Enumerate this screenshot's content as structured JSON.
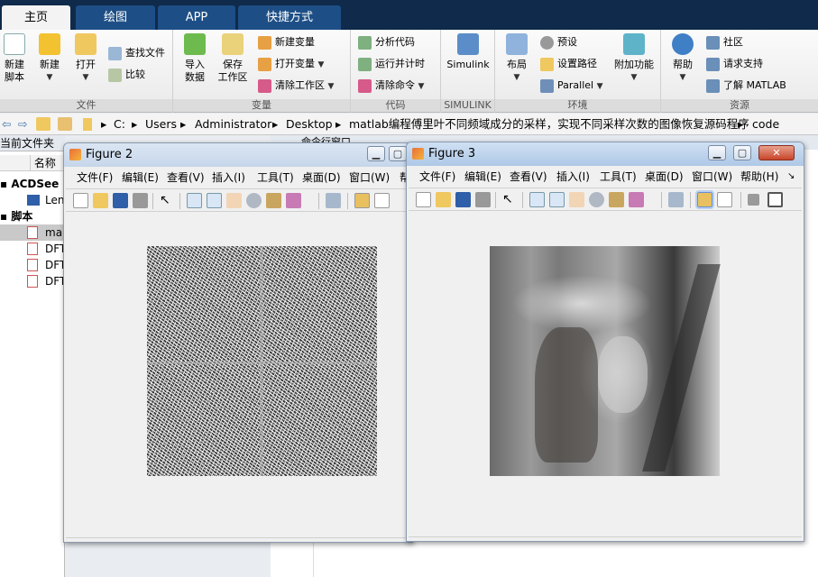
{
  "ribbon_tabs": [
    "主页",
    "绘图",
    "APP",
    "快捷方式"
  ],
  "ribbon": {
    "file": {
      "label": "文件",
      "new_script": "新建\n脚本",
      "new": "新建",
      "open": "打开",
      "find_files": "查找文件",
      "compare": "比较"
    },
    "variable": {
      "label": "变量",
      "import": "导入\n数据",
      "save_ws": "保存\n工作区",
      "new_var": "新建变量",
      "open_var": "打开变量",
      "clear_ws": "清除工作区"
    },
    "code": {
      "label": "代码",
      "analyze": "分析代码",
      "run_time": "运行并计时",
      "clear_cmd": "清除命令"
    },
    "simulink": {
      "label": "SIMULINK",
      "simulink": "Simulink"
    },
    "env": {
      "label": "环境",
      "layout": "布局",
      "prefs": "预设",
      "set_path": "设置路径",
      "parallel": "Parallel",
      "addons": "附加功能"
    },
    "resources": {
      "label": "资源",
      "help": "帮助",
      "community": "社区",
      "support": "请求支持",
      "learn": "了解 MATLAB"
    }
  },
  "address": [
    "C:",
    "Users",
    "Administrator",
    "Desktop",
    "matlab编程傅里叶不同频域成分的采样，实现不同采样次数的图像恢复源码程序",
    "code"
  ],
  "left_panel": {
    "header": "当前文件夹",
    "col_name": "名称",
    "items": [
      {
        "label": "ACDSee B"
      },
      {
        "label": "Len"
      },
      {
        "label": "脚本"
      },
      {
        "label": "ma"
      },
      {
        "label": "DFT"
      },
      {
        "label": "DFT"
      },
      {
        "label": "DFT"
      }
    ]
  },
  "cmd_window_title": "命令行窗口",
  "figure2": {
    "title": "Figure 2",
    "menus": [
      "文件(F)",
      "编辑(E)",
      "查看(V)",
      "插入(I)",
      "工具(T)",
      "桌面(D)",
      "窗口(W)",
      "帮"
    ]
  },
  "figure3": {
    "title": "Figure 3",
    "menus": [
      "文件(F)",
      "编辑(E)",
      "查看(V)",
      "插入(I)",
      "工具(T)",
      "桌面(D)",
      "窗口(W)",
      "帮助(H)"
    ]
  },
  "colors": {
    "accent": "#1d4f86",
    "titlebar": "#c6d6ea",
    "close": "#c8442a"
  }
}
